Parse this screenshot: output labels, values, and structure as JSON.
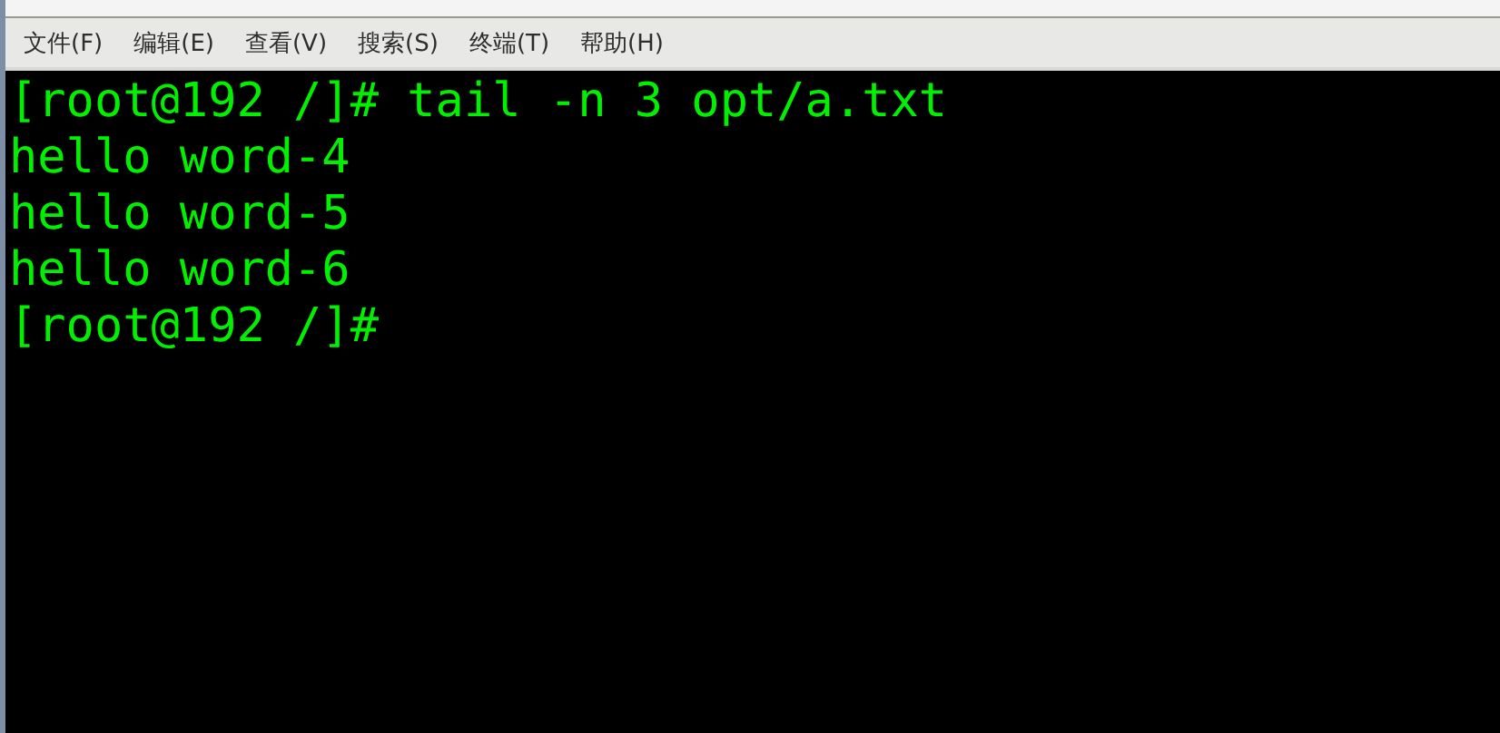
{
  "menu": [
    {
      "label": "文件(F)"
    },
    {
      "label": "编辑(E)"
    },
    {
      "label": "查看(V)"
    },
    {
      "label": "搜索(S)"
    },
    {
      "label": "终端(T)"
    },
    {
      "label": "帮助(H)"
    }
  ],
  "terminal": {
    "lines": [
      "[root@192 /]# tail -n 3 opt/a.txt",
      "hello word-4",
      "hello word-5",
      "hello word-6",
      "[root@192 /]#"
    ]
  }
}
